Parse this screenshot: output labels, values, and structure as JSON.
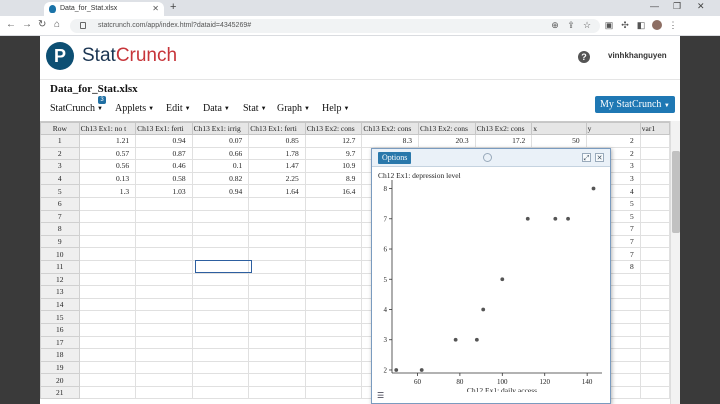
{
  "browser": {
    "tab_title": "Data_for_Stat.xlsx",
    "url": "statcrunch.com/app/index.html?dataid=4345269#"
  },
  "app": {
    "logo_letter": "P",
    "brand_part1": "Stat",
    "brand_part2": "Crunch",
    "username": "vinhkhanguyen",
    "help_glyph": "?"
  },
  "page_title": "Data_for_Stat.xlsx",
  "menus": [
    "StatCrunch",
    "Applets",
    "Edit",
    "Data",
    "Stat",
    "Graph",
    "Help"
  ],
  "menu_badge": "3",
  "my_statcrunch_label": "My StatCrunch",
  "sheet": {
    "row_header": "Row",
    "columns": [
      "Ch13 Ex1: no t",
      "Ch13 Ex1: ferti",
      "Ch13 Ex1: irrig",
      "Ch13 Ex1: ferti",
      "Ch13 Ex2: cons",
      "Ch13 Ex2: cons",
      "Ch13 Ex2: cons",
      "Ch13 Ex2: cons",
      "x",
      "y",
      "var1"
    ],
    "rows": [
      [
        "1.21",
        "0.94",
        "0.07",
        "0.85",
        "12.7",
        "8.3",
        "20.3",
        "17.2",
        "50",
        "2",
        ""
      ],
      [
        "0.57",
        "0.87",
        "0.66",
        "1.78",
        "9.7",
        "",
        "",
        "",
        "",
        "2",
        ""
      ],
      [
        "0.56",
        "0.46",
        "0.1",
        "1.47",
        "10.9",
        "",
        "",
        "",
        "",
        "3",
        ""
      ],
      [
        "0.13",
        "0.58",
        "0.82",
        "2.25",
        "8.9",
        "",
        "",
        "",
        "",
        "3",
        ""
      ],
      [
        "1.3",
        "1.03",
        "0.94",
        "1.64",
        "16.4",
        "",
        "",
        "",
        "",
        "4",
        ""
      ],
      [
        "",
        "",
        "",
        "",
        "",
        "",
        "",
        "",
        "",
        "5",
        ""
      ],
      [
        "",
        "",
        "",
        "",
        "",
        "",
        "",
        "",
        "",
        "5",
        ""
      ],
      [
        "",
        "",
        "",
        "",
        "",
        "",
        "",
        "",
        "",
        "7",
        ""
      ],
      [
        "",
        "",
        "",
        "",
        "",
        "",
        "",
        "",
        "",
        "7",
        ""
      ],
      [
        "",
        "",
        "",
        "",
        "",
        "",
        "",
        "",
        "",
        "7",
        ""
      ],
      [
        "",
        "",
        "",
        "",
        "",
        "",
        "",
        "",
        "",
        "8",
        ""
      ],
      [
        "",
        "",
        "",
        "",
        "",
        "",
        "",
        "",
        "",
        "",
        ""
      ],
      [
        "",
        "",
        "",
        "",
        "",
        "",
        "",
        "",
        "",
        "",
        ""
      ],
      [
        "",
        "",
        "",
        "",
        "",
        "",
        "",
        "",
        "",
        "",
        ""
      ],
      [
        "",
        "",
        "",
        "",
        "",
        "",
        "",
        "",
        "",
        "",
        ""
      ],
      [
        "",
        "",
        "",
        "",
        "",
        "",
        "",
        "",
        "",
        "",
        ""
      ],
      [
        "",
        "",
        "",
        "",
        "",
        "",
        "",
        "",
        "",
        "",
        ""
      ],
      [
        "",
        "",
        "",
        "",
        "",
        "",
        "",
        "",
        "",
        "",
        ""
      ],
      [
        "",
        "",
        "",
        "",
        "",
        "",
        "",
        "",
        "",
        "",
        ""
      ],
      [
        "",
        "",
        "",
        "",
        "",
        "",
        "",
        "",
        "",
        "",
        ""
      ],
      [
        "",
        "",
        "",
        "",
        "",
        "",
        "",
        "",
        "",
        "",
        ""
      ]
    ]
  },
  "graph_window": {
    "options_label": "Options"
  },
  "chart_data": {
    "type": "scatter",
    "title": "",
    "xlabel": "Ch12 Ex1: daily access",
    "ylabel": "Ch12 Ex1: depression level",
    "x": [
      50,
      62,
      78,
      88,
      91,
      100,
      112,
      125,
      131,
      143
    ],
    "y": [
      2,
      2,
      3,
      3,
      4,
      5,
      7,
      7,
      7,
      8
    ],
    "xlim": [
      48,
      147
    ],
    "ylim": [
      1.9,
      8.15
    ],
    "xticks": [
      60,
      80,
      100,
      120,
      140
    ],
    "yticks": [
      2,
      3,
      4,
      5,
      6,
      7,
      8
    ],
    "grid": false,
    "point_color": "#555555"
  }
}
